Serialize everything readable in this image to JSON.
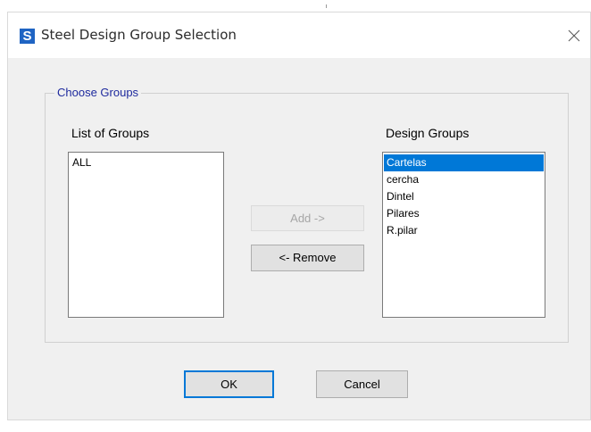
{
  "dialog": {
    "title": "Steel Design Group Selection",
    "app_icon_letter": "S",
    "close_glyph": "close-icon"
  },
  "groupbox": {
    "legend": "Choose Groups"
  },
  "list_of_groups": {
    "label": "List of Groups",
    "items": [
      "ALL"
    ]
  },
  "design_groups": {
    "label": "Design Groups",
    "items": [
      "Cartelas",
      "cercha",
      "Dintel",
      "Pilares",
      "R.pilar"
    ],
    "selected_item": "Cartelas"
  },
  "buttons": {
    "add": "Add ->",
    "remove": "<- Remove",
    "ok": "OK",
    "cancel": "Cancel"
  },
  "colors": {
    "selection": "#0078d7",
    "legend_text": "#1e2a9e",
    "app_icon": "#1f64c3"
  }
}
